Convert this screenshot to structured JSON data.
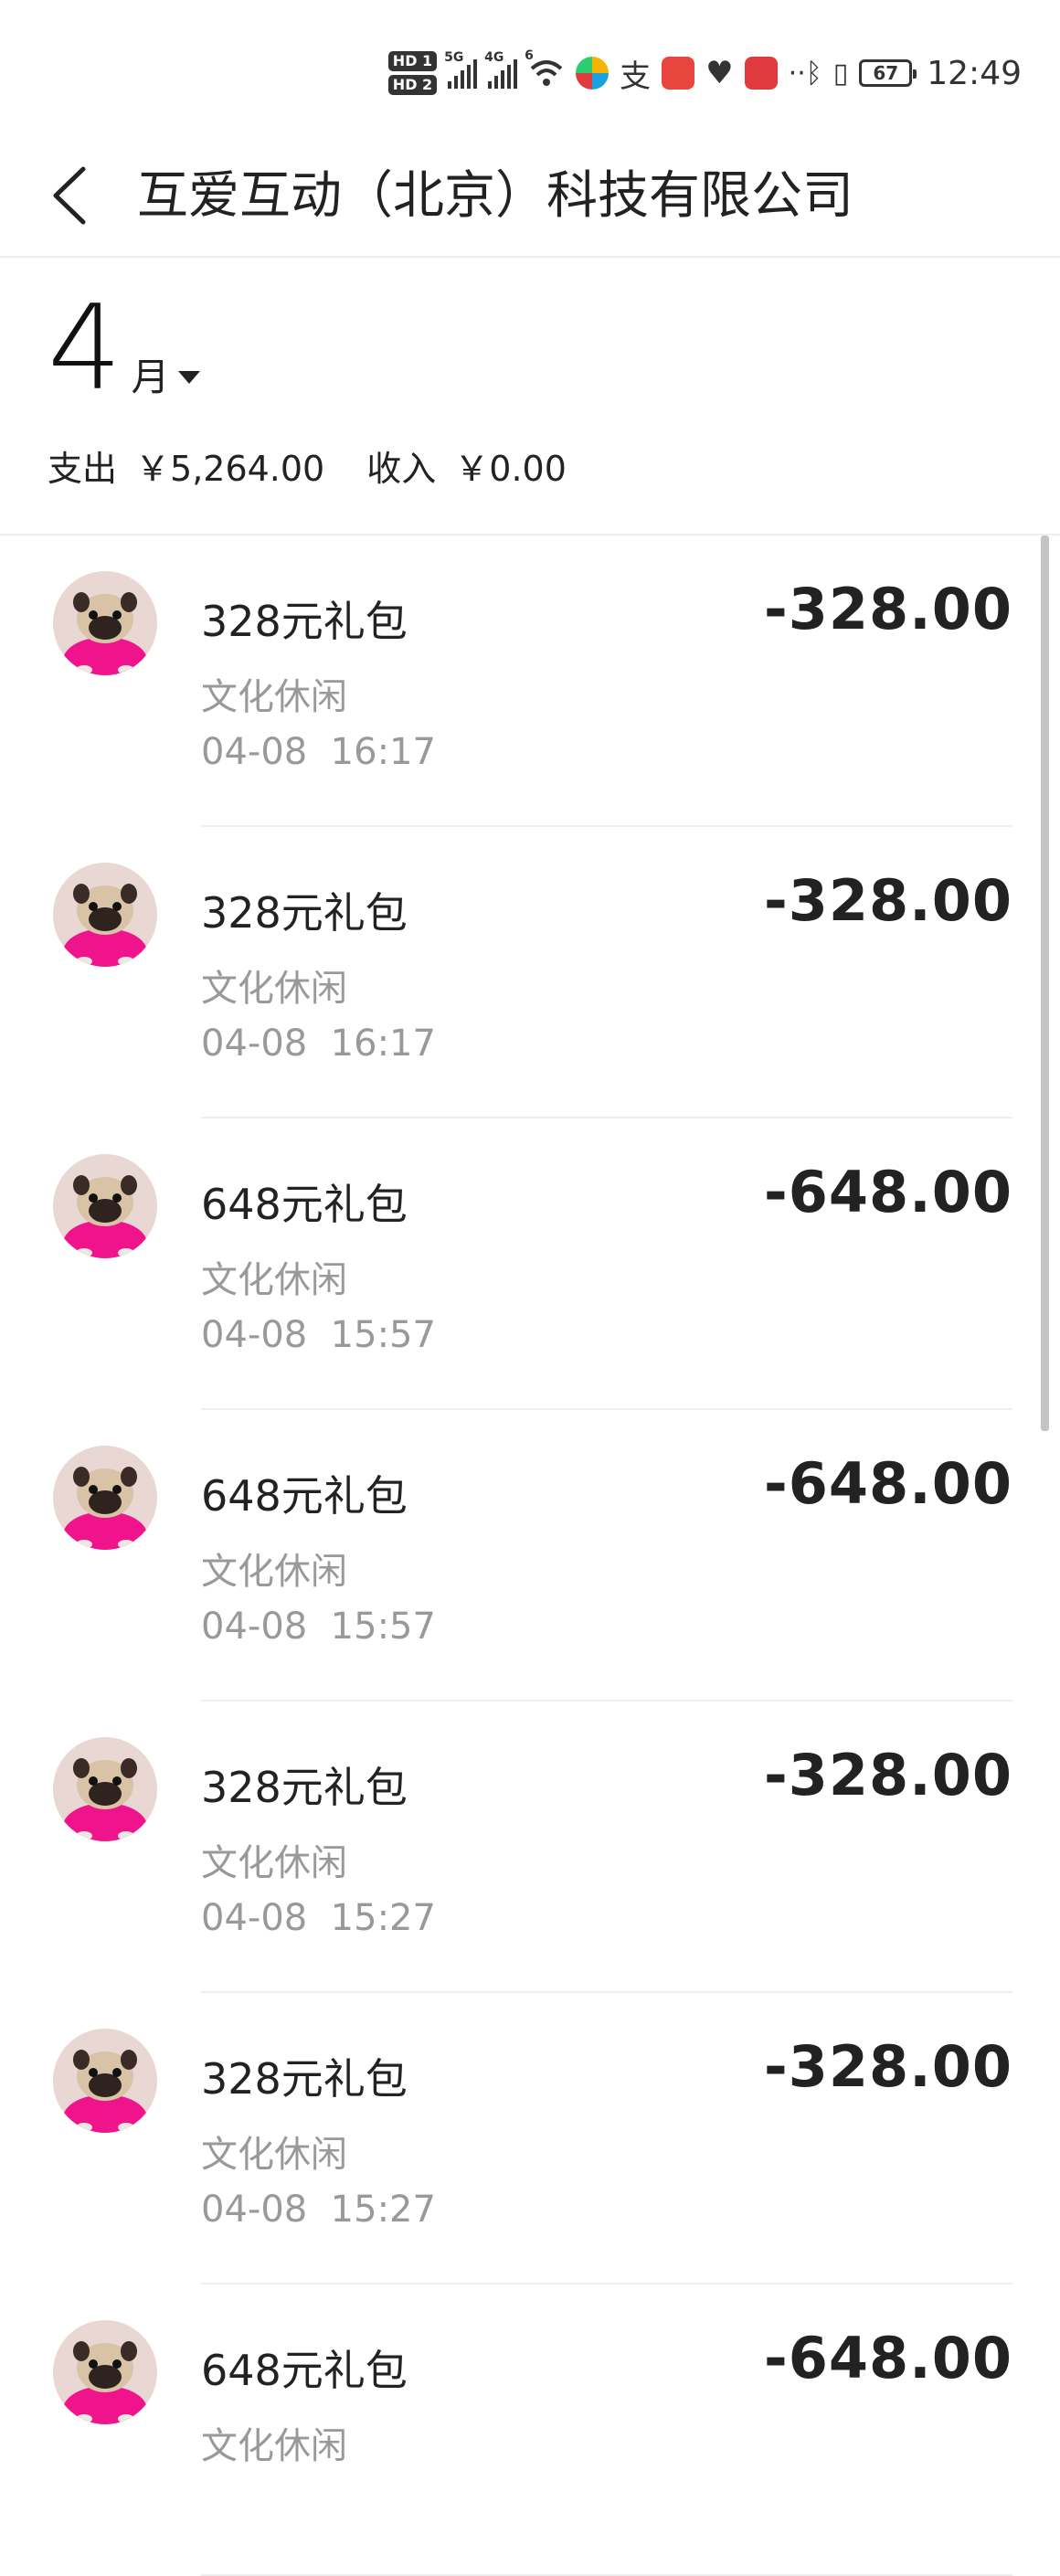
{
  "status_bar": {
    "hd1": "HD 1",
    "hd2": "HD 2",
    "net1": "5G",
    "net2": "4G",
    "wifi_badge": "6",
    "battery": "67",
    "time": "12:49",
    "icons": [
      "signal-icon",
      "wifi-icon",
      "app-icon",
      "alipay-icon",
      "book-icon",
      "health-icon",
      "huawei-icon",
      "bluetooth-icon",
      "vibrate-icon",
      "battery-icon"
    ]
  },
  "header": {
    "title": "互爱互动（北京）科技有限公司"
  },
  "summary": {
    "month": "4",
    "month_unit": "月",
    "expense_label": "支出",
    "expense_value": "￥5,264.00",
    "income_label": "收入",
    "income_value": "￥0.00"
  },
  "transactions": [
    {
      "title": "328元礼包",
      "category": "文化休闲",
      "date": "04-08",
      "time": "16:17",
      "amount": "-328.00"
    },
    {
      "title": "328元礼包",
      "category": "文化休闲",
      "date": "04-08",
      "time": "16:17",
      "amount": "-328.00"
    },
    {
      "title": "648元礼包",
      "category": "文化休闲",
      "date": "04-08",
      "time": "15:57",
      "amount": "-648.00"
    },
    {
      "title": "648元礼包",
      "category": "文化休闲",
      "date": "04-08",
      "time": "15:57",
      "amount": "-648.00"
    },
    {
      "title": "328元礼包",
      "category": "文化休闲",
      "date": "04-08",
      "time": "15:27",
      "amount": "-328.00"
    },
    {
      "title": "328元礼包",
      "category": "文化休闲",
      "date": "04-08",
      "time": "15:27",
      "amount": "-328.00"
    },
    {
      "title": "648元礼包",
      "category": "文化休闲",
      "date": "",
      "time": "",
      "amount": "-648.00"
    }
  ]
}
